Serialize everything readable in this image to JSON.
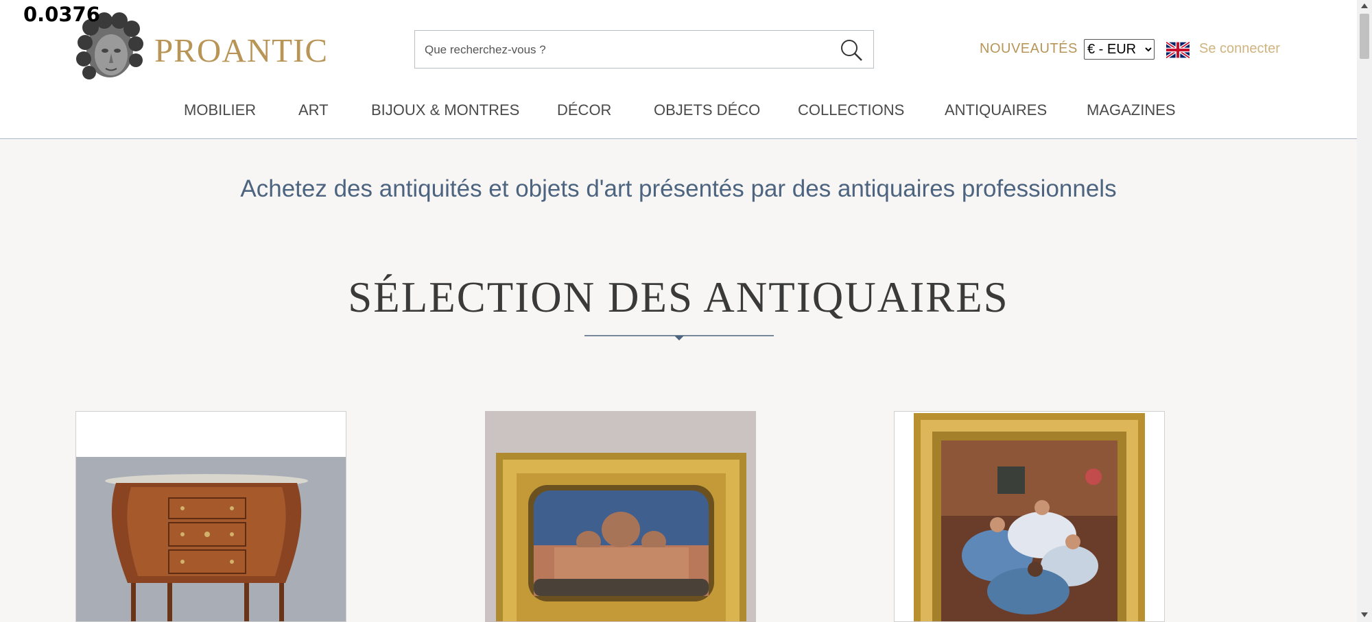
{
  "overlay_value": "0.0376",
  "header": {
    "brand": "PROANTIC",
    "logo_icon": "sculpture-head-icon",
    "search": {
      "placeholder": "Que recherchez-vous ?",
      "icon": "search-icon"
    },
    "new_label": "NOUVEAUTÉS",
    "currency": {
      "selected": "€ - EUR",
      "options": [
        "€ - EUR"
      ]
    },
    "language_icon": "uk-flag-icon",
    "login_label": "Se connecter"
  },
  "nav": {
    "items": [
      {
        "label": "MOBILIER"
      },
      {
        "label": "ART"
      },
      {
        "label": "BIJOUX & MONTRES"
      },
      {
        "label": "DÉCOR"
      },
      {
        "label": "OBJETS DÉCO"
      },
      {
        "label": "COLLECTIONS"
      },
      {
        "label": "ANTIQUAIRES"
      },
      {
        "label": "MAGAZINES"
      }
    ]
  },
  "main": {
    "tagline": "Achetez des antiquités et objets d'art présentés par des antiquaires professionnels",
    "section_title": "SÉLECTION DES ANTIQUAIRES",
    "products": [
      {
        "image": "demilune-commode-image"
      },
      {
        "image": "venice-painting-gilt-frame-image"
      },
      {
        "image": "ballerinas-painting-gilt-frame-image"
      }
    ]
  },
  "colors": {
    "brand_gold": "#b89556",
    "tagline_blue": "#4d6480",
    "login_gold": "#cfb47f",
    "page_bg": "#f7f6f4"
  }
}
